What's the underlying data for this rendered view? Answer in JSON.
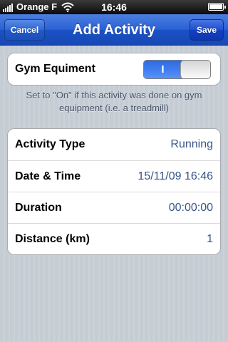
{
  "status_bar": {
    "carrier": "Orange F",
    "time": "16:46",
    "signal_icon": "signal-bars-icon",
    "wifi_icon": "wifi-icon",
    "battery_icon": "battery-icon",
    "battery_level": 1.0
  },
  "nav": {
    "title": "Add Activity",
    "cancel_label": "Cancel",
    "save_label": "Save"
  },
  "gym": {
    "label": "Gym Equiment",
    "toggle_on_text": "I",
    "toggle_state": "on",
    "footer_line1": "Set to \"On\"  if this activity was done on gym",
    "footer_line2": "equipment (i.e. a treadmill)"
  },
  "details": {
    "rows": [
      {
        "label": "Activity Type",
        "value": "Running"
      },
      {
        "label": "Date & Time",
        "value": "15/11/09 16:46"
      },
      {
        "label": "Duration",
        "value": "00:00:00"
      },
      {
        "label": "Distance (km)",
        "value": "1"
      }
    ]
  },
  "colors": {
    "nav_bar": "#2a62d4",
    "value_text": "#385487",
    "background": "#c5ccd4",
    "toggle_on": "#3e7df0"
  }
}
